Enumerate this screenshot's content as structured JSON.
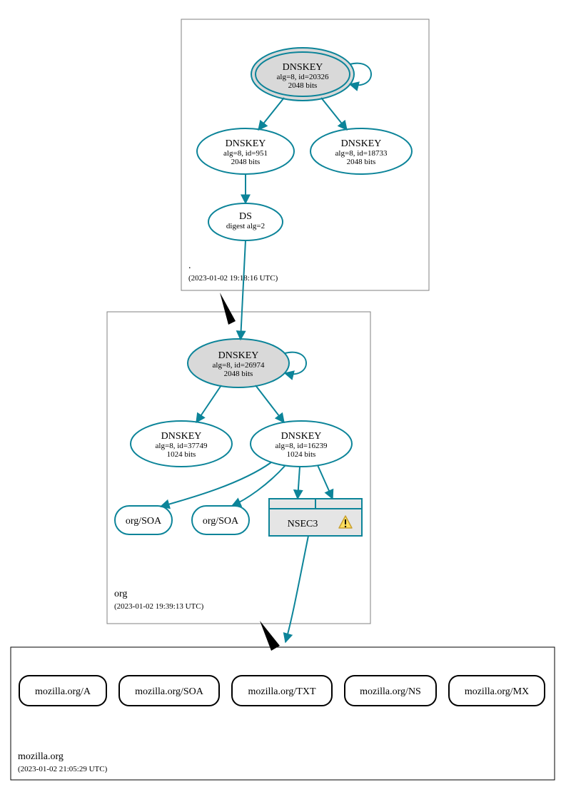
{
  "colors": {
    "teal": "#0c8499",
    "node_fill_gray": "#d9d9d9",
    "node_fill_white": "#ffffff",
    "black": "#000000",
    "warn_fill": "#ffdf5e",
    "warn_stroke": "#c8a032",
    "box_stroke": "#808080"
  },
  "zone_root": {
    "label": ".",
    "timestamp": "(2023-01-02 19:18:16 UTC)",
    "key_root": {
      "title": "DNSKEY",
      "line1": "alg=8, id=20326",
      "line2": "2048 bits"
    },
    "key_left": {
      "title": "DNSKEY",
      "line1": "alg=8, id=951",
      "line2": "2048 bits"
    },
    "key_right": {
      "title": "DNSKEY",
      "line1": "alg=8, id=18733",
      "line2": "2048 bits"
    },
    "ds": {
      "title": "DS",
      "line1": "digest alg=2"
    }
  },
  "zone_org": {
    "label": "org",
    "timestamp": "(2023-01-02 19:39:13 UTC)",
    "key_root": {
      "title": "DNSKEY",
      "line1": "alg=8, id=26974",
      "line2": "2048 bits"
    },
    "key_left": {
      "title": "DNSKEY",
      "line1": "alg=8, id=37749",
      "line2": "1024 bits"
    },
    "key_right": {
      "title": "DNSKEY",
      "line1": "alg=8, id=16239",
      "line2": "1024 bits"
    },
    "soa1": {
      "label": "org/SOA"
    },
    "soa2": {
      "label": "org/SOA"
    },
    "nsec3": {
      "label": "NSEC3"
    }
  },
  "zone_mozilla": {
    "label": "mozilla.org",
    "timestamp": "(2023-01-02 21:05:29 UTC)",
    "records": [
      "mozilla.org/A",
      "mozilla.org/SOA",
      "mozilla.org/TXT",
      "mozilla.org/NS",
      "mozilla.org/MX"
    ]
  }
}
